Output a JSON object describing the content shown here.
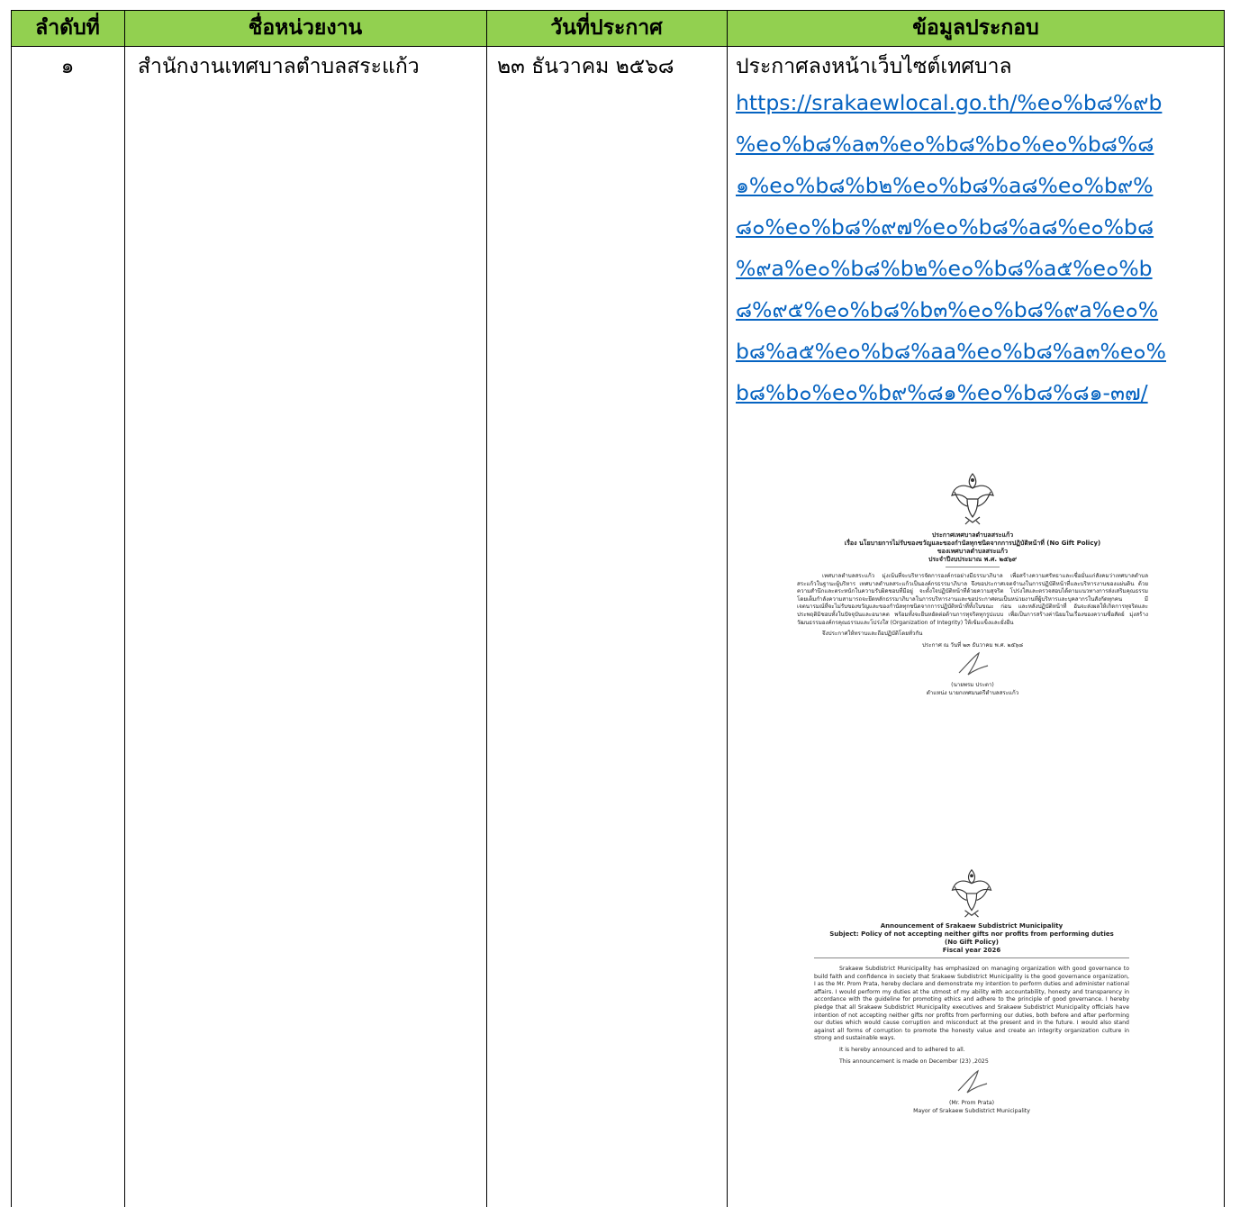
{
  "table": {
    "headers": [
      "ลำดับที่",
      "ชื่อหน่วยงาน",
      "วันที่ประกาศ",
      "ข้อมูลประกอบ"
    ],
    "row": {
      "number": "๑",
      "agency": "สำนักงานเทศบาลตำบลสระแก้ว",
      "date": "๒๓ ธันวาคม ๒๕๖๘",
      "info_heading": "ประกาศลงหน้าเว็บไซต์เทศบาล",
      "link_lines": [
        "https://srakaewlocal.go.th/%e๐%b๘%๙b",
        "%e๐%b๘%a๓%e๐%b๘%b๐%e๐%b๘%๘",
        "๑%e๐%b๘%b๒%e๐%b๘%a๘%e๐%b๙%",
        "๘๐%e๐%b๘%๙๗%e๐%b๘%a๘%e๐%b๘",
        "%๙a%e๐%b๘%b๒%e๐%b๘%a๕%e๐%b",
        "๘%๙๕%e๐%b๘%b๓%e๐%b๘%๙a%e๐%",
        "b๘%a๕%e๐%b๘%aa%e๐%b๘%a๓%e๐%",
        "b๘%b๐%e๐%b๙%๘๑%e๐%b๘%๘๑-๓๗/"
      ]
    }
  },
  "thai_doc": {
    "title_lines": [
      "ประกาศเทศบาลตำบลสระแก้ว",
      "เรื่อง นโยบายการไม่รับของขวัญและของกำนัลทุกชนิดจากการปฏิบัติหน้าที่ (No Gift Policy)",
      "ของเทศบาลตำบลสระแก้ว",
      "ประจำปีงบประมาณ พ.ศ. ๒๕๖๙"
    ],
    "body": "เทศบาลตำบลสระแก้ว มุ่งเน้นที่จะบริหารจัดการองค์กรอย่างมีธรรมาภิบาล เพื่อสร้างความศรัทธาและเชื่อมั่นแก่สังคมว่าเทศบาลตำบลสระแก้วในฐานะผู้บริหาร เทศบาลตำบลสระแก้วเป็นองค์กรธรรมาภิบาล จึงขอประกาศเจตจำนงในการปฏิบัติหน้าที่และบริหารงานของแผ่นดิน ด้วยความสำนึกและตระหนักในความรับผิดชอบที่มีอยู่ จะตั้งใจปฏิบัติหน้าที่ด้วยความสุจริต โปร่งใสและตรวจสอบได้ตามแนวทางการส่งเสริมคุณธรรม โดยเต็มกำลังความสามารถจะยึดหลักธรรมาภิบาลในการบริหารงานและขอประกาศตนเป็นหน่วยงานที่ผู้บริหารและบุคลากรในสังกัดทุกคน มีเจตนารมณ์ที่จะไม่รับของขวัญและของกำนัลทุกชนิดจากการปฏิบัติหน้าที่ทั้งในขณะ ก่อน และหลังปฏิบัติหน้าที่ อันจะส่งผลให้เกิดการทุจริตและประพฤติมิชอบทั้งในปัจจุบันและอนาคต พร้อมทั้งจะยืนหยัดต่อต้านการทุจริตทุกรูปแบบ เพื่อเป็นการสร้างค่านิยมในเรื่องของความซื่อสัตย์ มุ่งสร้างวัฒนธรรมองค์กรคุณธรรมและโปร่งใส (Organization of Integrity) ให้เข้มแข็งและยั่งยืน",
    "announce": "จึงประกาศให้ทราบและถือปฏิบัติโดยทั่วกัน",
    "date_line": "ประกาศ ณ วันที่ ๒๓ ธันวาคม พ.ศ. ๒๕๖๘",
    "signer": "(นายพรม ประตา)",
    "position": "ตำแหน่ง นายกเทศมนตรีตำบลสระแก้ว"
  },
  "eng_doc": {
    "title_lines": [
      "Announcement of Srakaew Subdistrict Municipality",
      "Subject: Policy of not accepting neither gifts nor profits from performing duties",
      "(No Gift Policy)",
      "Fiscal year 2026"
    ],
    "body": "Srakaew Subdistrict Municipality has emphasized on managing organization with good governance to build faith and confidence in society that Srakaew Subdistrict Municipality is the good governance organization, I as the Mr. Prom Prata, hereby declare and demonstrate my intention to perform duties and administer national affairs. I would perform my duties at the utmost of my ability with accountability, honesty and transparency in accordance with the guideline for promoting ethics and adhere to the principle of good governance. I hereby pledge that all Srakaew Subdistrict Municipality executives and Srakaew Subdistrict Municipality officials have intention of not accepting neither gifts nor profits from performing our duties, both before and after performing our duties which would cause corruption and misconduct at the present and in the future. I would also stand against all forms of corruption to promote the honesty value and create an integrity organization culture in strong and sustainable ways.",
    "announce": "It is hereby announced and to adhered to all.",
    "date_line": "This announcement is made on December (23) ,2025",
    "signer": "(Mr. Prom Prata)",
    "position": "Mayor of Srakaew Subdistrict Municipality"
  },
  "colors": {
    "header_bg": "#92d050",
    "link": "#0563c1"
  }
}
